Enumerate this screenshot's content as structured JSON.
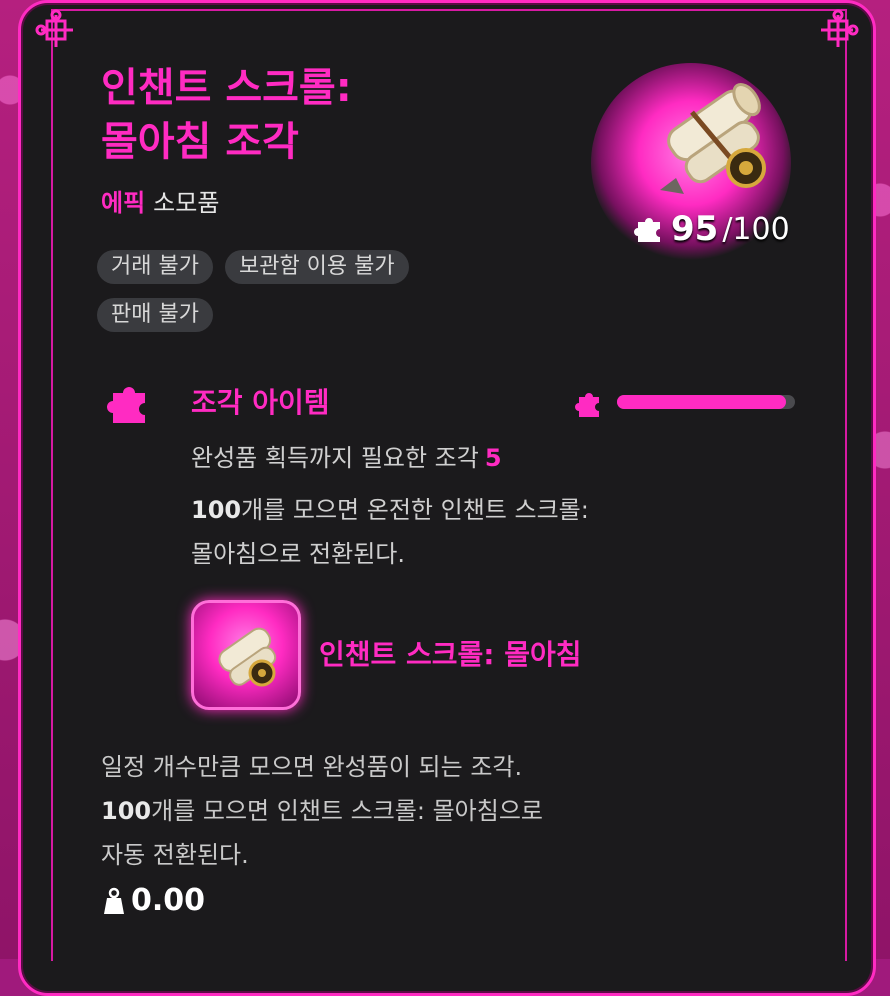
{
  "item": {
    "title_line1": "인챈트 스크롤:",
    "title_line2": "몰아침 조각",
    "rarity": "에픽",
    "category": "소모품",
    "tags": [
      "거래 불가",
      "보관함 이용 불가",
      "판매 불가"
    ],
    "count_current": "95",
    "count_total": "/100"
  },
  "fragment": {
    "section_title": "조각 아이템",
    "progress": 0.95,
    "required_label": "완성품 획득까지 필요한 조각",
    "required_count": "5",
    "convert_count": "100",
    "convert_line1_rest": "개를 모으면 온전한 인챈트 스크롤:",
    "convert_line2": "몰아침으로 전환된다.",
    "result_name": "인챈트 스크롤: 몰아침"
  },
  "description": {
    "line1": "일정 개수만큼 모으면 완성품이 되는 조각.",
    "line2_count": "100",
    "line2_rest": "개를 모으면 인챈트 스크롤: 몰아침으로",
    "line3": "자동 전환된다."
  },
  "weight": "0.00",
  "colors": {
    "accent": "#ff2bc2",
    "panel_bg": "#1b1a1c",
    "tag_bg": "#3a3b3f"
  }
}
